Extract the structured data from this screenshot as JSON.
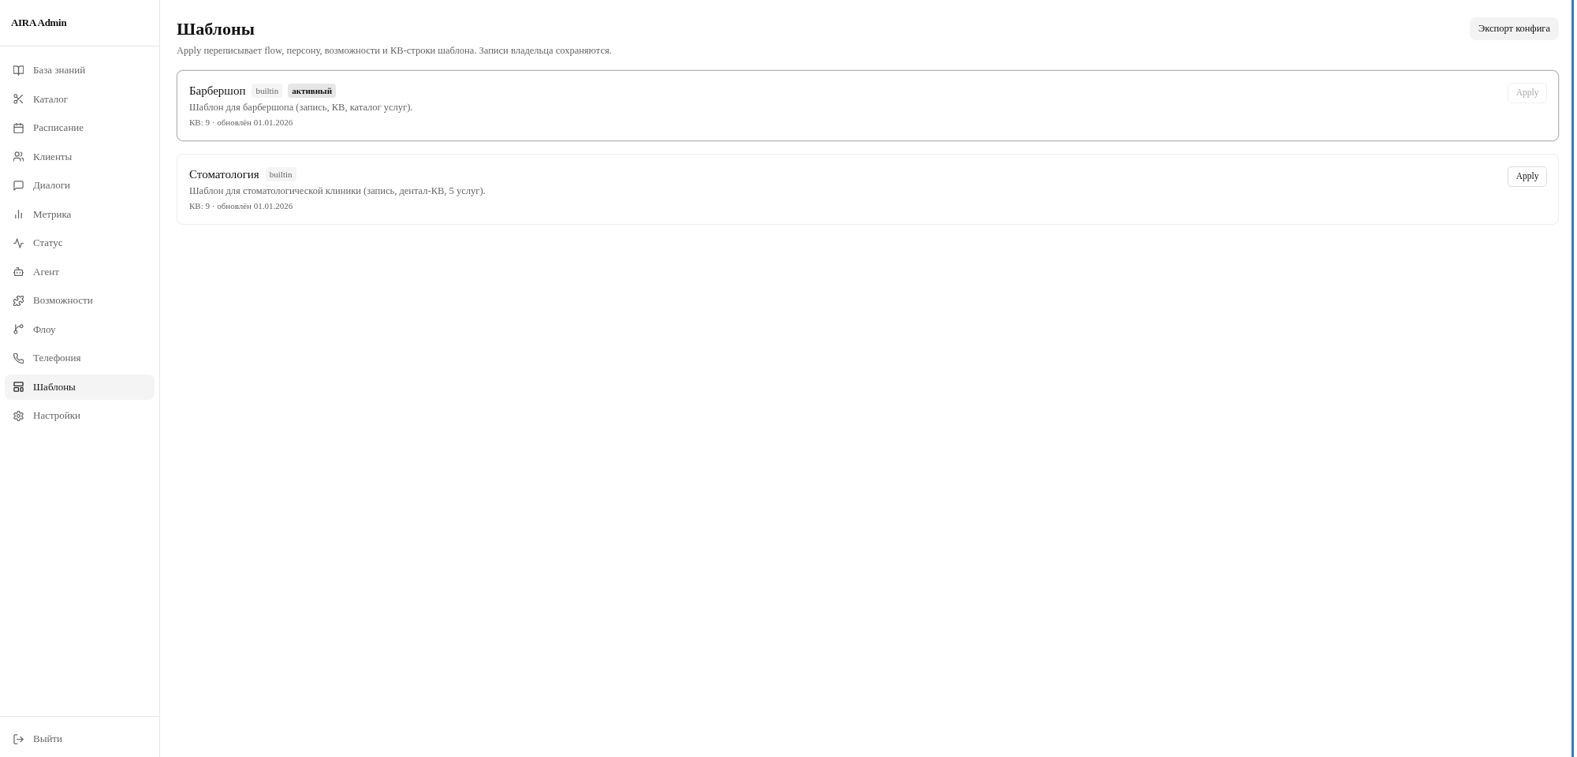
{
  "sidebar": {
    "brand": "AIRA Admin",
    "nav": [
      {
        "label": "База знаний",
        "selected": false
      },
      {
        "label": "Каталог",
        "selected": false
      },
      {
        "label": "Расписание",
        "selected": false
      },
      {
        "label": "Клиенты",
        "selected": false
      },
      {
        "label": "Диалоги",
        "selected": false
      },
      {
        "label": "Метрика",
        "selected": false
      },
      {
        "label": "Статус",
        "selected": false
      },
      {
        "label": "Агент",
        "selected": false
      },
      {
        "label": "Возможности",
        "selected": false
      },
      {
        "label": "Флоу",
        "selected": false
      },
      {
        "label": "Телефония",
        "selected": false
      },
      {
        "label": "Шаблоны",
        "selected": true
      },
      {
        "label": "Настройки",
        "selected": false
      }
    ],
    "logout": "Выйти"
  },
  "header": {
    "title": "Шаблоны",
    "subtitle": "Apply переписывает flow, персону, возможности и КВ-строки шаблона. Записи владельца сохраняются.",
    "export_button": "Экспорт конфига"
  },
  "templates": [
    {
      "name": "Барбершоп",
      "badges": [
        {
          "label": "builtin",
          "kind": "source"
        },
        {
          "label": "активный",
          "kind": "status"
        }
      ],
      "active": true,
      "description": "Шаблон для барбершопа (запись, КВ, каталог услуг).",
      "meta": "КВ: 9 · обновлён 01.01.2026",
      "apply": {
        "label": "Apply",
        "disabled": true
      }
    },
    {
      "name": "Стоматология",
      "badges": [
        {
          "label": "builtin",
          "kind": "source"
        }
      ],
      "active": false,
      "description": "Шаблон для стоматологической клиники (запись, дентал-КВ, 5 услуг).",
      "meta": "КВ: 9 · обновлён 01.01.2026",
      "apply": {
        "label": "Apply",
        "disabled": false
      }
    }
  ]
}
